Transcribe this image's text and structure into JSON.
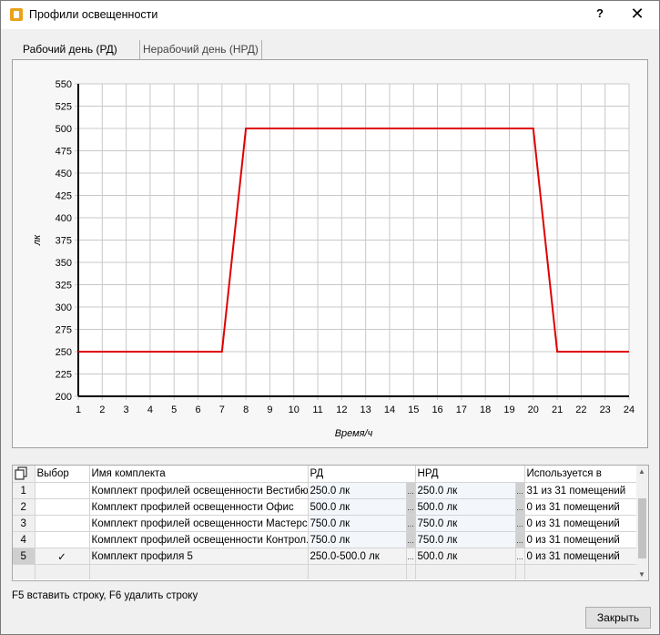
{
  "window": {
    "title": "Профили освещенности",
    "help_label": "?",
    "close_label": "✕"
  },
  "tabs": [
    {
      "label": "Рабочий день (РД)",
      "active": true
    },
    {
      "label": "Нерабочий день (НРД)",
      "active": false
    }
  ],
  "chart_data": {
    "type": "line",
    "xlabel": "Время/ч",
    "ylabel": "лк",
    "xlim": [
      1,
      24
    ],
    "ylim": [
      200,
      550
    ],
    "x_ticks": [
      1,
      2,
      3,
      4,
      5,
      6,
      7,
      8,
      9,
      10,
      11,
      12,
      13,
      14,
      15,
      16,
      17,
      18,
      19,
      20,
      21,
      22,
      23,
      24
    ],
    "y_ticks": [
      200,
      225,
      250,
      275,
      300,
      325,
      350,
      375,
      400,
      425,
      450,
      475,
      500,
      525,
      550
    ],
    "grid": true,
    "series": [
      {
        "color": "#e00000",
        "x": [
          1,
          7,
          8,
          20,
          21,
          24
        ],
        "y": [
          250,
          250,
          500,
          500,
          250,
          250
        ]
      }
    ]
  },
  "table": {
    "headers": [
      "",
      "Выбор",
      "Имя комплекта",
      "РД",
      "",
      "НРД",
      "",
      "Используется в"
    ],
    "rows": [
      {
        "num": "1",
        "choice": "",
        "name": "Комплект профилей освещенности Вестибюль",
        "rd": "250.0 лк",
        "nrd": "250.0 лк",
        "used": "31 из 31 помещений"
      },
      {
        "num": "2",
        "choice": "",
        "name": "Комплект профилей освещенности Офис",
        "rd": "500.0 лк",
        "nrd": "500.0 лк",
        "used": "0 из 31 помещений"
      },
      {
        "num": "3",
        "choice": "",
        "name": "Комплект профилей освещенности Мастерс...",
        "rd": "750.0 лк",
        "nrd": "750.0 лк",
        "used": "0 из 31 помещений"
      },
      {
        "num": "4",
        "choice": "",
        "name": "Комплект профилей освещенности Контрол...",
        "rd": "750.0 лк",
        "nrd": "750.0 лк",
        "used": "0 из 31 помещений"
      },
      {
        "num": "5",
        "choice": "✓",
        "name": "Комплект профиля 5",
        "rd": "250.0-500.0 лк",
        "nrd": "500.0 лк",
        "used": "0 из 31 помещений"
      }
    ],
    "ellipsis": "..."
  },
  "hint": "F5 вставить строку, F6 удалить строку",
  "close_button": "Закрыть"
}
